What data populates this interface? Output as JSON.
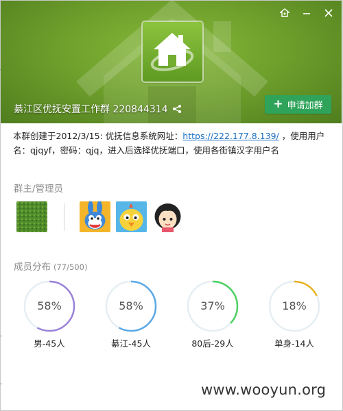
{
  "window": {
    "controls": [
      {
        "name": "skin-icon"
      },
      {
        "name": "minimize-icon"
      },
      {
        "name": "close-icon"
      }
    ]
  },
  "header": {
    "group_name": "綦江区优抚安置工作群 220844314",
    "join_label": "申请加群",
    "join_icon": "+"
  },
  "description": {
    "text_before_link": "本群创建于2012/3/15:  优抚信息系统网址：",
    "link": "https://222.177.8.139/",
    "text_after_link": " ，使用用户名：qjqyf，密码：qjq，进入后选择优抚端口，使用各街镇汉字用户名"
  },
  "admins": {
    "label": "群主/管理员",
    "owner_avatar": "grass-avatar",
    "members": [
      "bunny-avatar",
      "chick-avatar",
      "girl-avatar"
    ]
  },
  "distribution": {
    "label": "成员分布",
    "count": "(77/500)",
    "stats": [
      {
        "percent_text": "58%",
        "label": "男-45人",
        "fraction": 0.58,
        "color": "#9b82d9"
      },
      {
        "percent_text": "58%",
        "label": "綦江-45人",
        "fraction": 0.58,
        "color": "#5aa9e6"
      },
      {
        "percent_text": "37%",
        "label": "80后-29人",
        "fraction": 0.37,
        "color": "#4cd060"
      },
      {
        "percent_text": "18%",
        "label": "单身-14人",
        "fraction": 0.18,
        "color": "#e8b21e"
      }
    ]
  },
  "watermark": "www.wooyun.org"
}
